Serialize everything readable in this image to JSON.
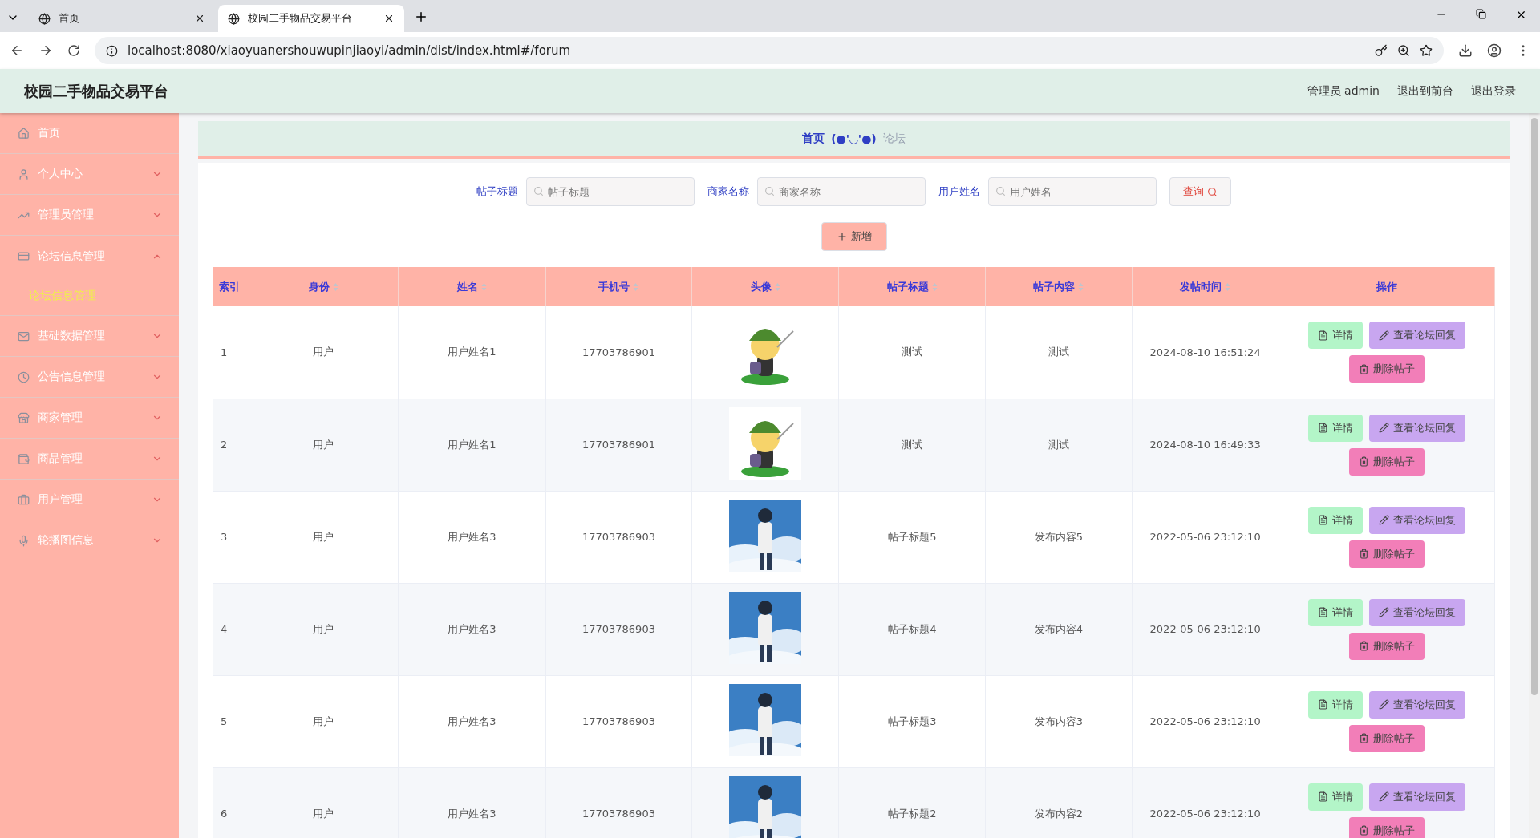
{
  "browser": {
    "tabs": [
      {
        "title": "首页",
        "selected": false
      },
      {
        "title": "校园二手物品交易平台",
        "selected": true
      }
    ],
    "url": "localhost:8080/xiaoyuanershouwupinjiaoyi/admin/dist/index.html#/forum"
  },
  "header": {
    "title": "校园二手物品交易平台",
    "user": "管理员 admin",
    "links": [
      "退出到前台",
      "退出登录"
    ]
  },
  "sidebar": {
    "items": [
      {
        "label": "首页"
      },
      {
        "label": "个人中心",
        "expanded": false
      },
      {
        "label": "管理员管理",
        "expanded": false
      },
      {
        "label": "论坛信息管理",
        "expanded": true,
        "children": [
          {
            "label": "论坛信息管理",
            "selected": true
          }
        ]
      },
      {
        "label": "基础数据管理",
        "expanded": false
      },
      {
        "label": "公告信息管理",
        "expanded": false
      },
      {
        "label": "商家管理",
        "expanded": false
      },
      {
        "label": "商品管理",
        "expanded": false
      },
      {
        "label": "用户管理",
        "expanded": false
      },
      {
        "label": "轮播图信息",
        "expanded": false
      }
    ]
  },
  "breadcrumb": {
    "home": "首页",
    "separator": "(●'◡'●)",
    "current": "论坛"
  },
  "search": {
    "fields": [
      {
        "label": "帖子标题",
        "placeholder": "帖子标题"
      },
      {
        "label": "商家名称",
        "placeholder": "商家名称"
      },
      {
        "label": "用户姓名",
        "placeholder": "用户姓名"
      }
    ],
    "query_button": "查询",
    "add_button": "新增"
  },
  "table": {
    "columns": [
      {
        "label": "索引",
        "sortable": false
      },
      {
        "label": "身份",
        "sortable": true
      },
      {
        "label": "姓名",
        "sortable": true
      },
      {
        "label": "手机号",
        "sortable": true
      },
      {
        "label": "头像",
        "sortable": true
      },
      {
        "label": "帖子标题",
        "sortable": true
      },
      {
        "label": "帖子内容",
        "sortable": true
      },
      {
        "label": "发帖时间",
        "sortable": true
      },
      {
        "label": "操作",
        "sortable": false
      }
    ],
    "rows": [
      {
        "index": "1",
        "role": "用户",
        "name": "用户姓名1",
        "phone": "17703786901",
        "title": "测试",
        "content": "测试",
        "time": "2024-08-10 16:51:24",
        "actions": [
          "详情",
          "查看论坛回复",
          "删除帖子"
        ]
      },
      {
        "index": "2",
        "role": "用户",
        "name": "用户姓名1",
        "phone": "17703786901",
        "title": "测试",
        "content": "测试",
        "time": "2024-08-10 16:49:33",
        "actions": [
          "详情",
          "查看论坛回复",
          "删除帖子"
        ]
      },
      {
        "index": "3",
        "role": "用户",
        "name": "用户姓名3",
        "phone": "17703786903",
        "title": "帖子标题5",
        "content": "发布内容5",
        "time": "2022-05-06 23:12:10",
        "actions": [
          "详情",
          "查看论坛回复",
          "删除帖子"
        ]
      },
      {
        "index": "4",
        "role": "用户",
        "name": "用户姓名3",
        "phone": "17703786903",
        "title": "帖子标题4",
        "content": "发布内容4",
        "time": "2022-05-06 23:12:10",
        "actions": [
          "详情",
          "查看论坛回复",
          "删除帖子"
        ]
      },
      {
        "index": "5",
        "role": "用户",
        "name": "用户姓名3",
        "phone": "17703786903",
        "title": "帖子标题3",
        "content": "发布内容3",
        "time": "2022-05-06 23:12:10",
        "actions": [
          "详情",
          "查看论坛回复",
          "删除帖子"
        ]
      },
      {
        "index": "6",
        "role": "用户",
        "name": "用户姓名3",
        "phone": "17703786903",
        "title": "帖子标题2",
        "content": "发布内容2",
        "time": "2022-05-06 23:12:10",
        "actions": [
          "详情",
          "查看论坛回复",
          "删除帖子"
        ]
      }
    ]
  }
}
